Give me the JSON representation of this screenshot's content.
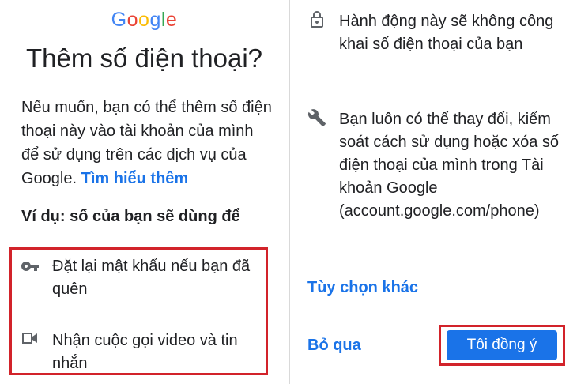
{
  "logo": {
    "letters": [
      {
        "ch": "G",
        "color": "#4285F4"
      },
      {
        "ch": "o",
        "color": "#EA4335"
      },
      {
        "ch": "o",
        "color": "#FBBC05"
      },
      {
        "ch": "g",
        "color": "#4285F4"
      },
      {
        "ch": "l",
        "color": "#34A853"
      },
      {
        "ch": "e",
        "color": "#EA4335"
      }
    ]
  },
  "left": {
    "title": "Thêm số điện thoại?",
    "body": "Nếu muốn, bạn có thể thêm số điện thoại này vào tài khoản của mình để sử dụng trên các dịch vụ của Google.",
    "learn_more": "Tìm hiểu thêm",
    "subhead": "Ví dụ: số của bạn sẽ dùng để",
    "items": [
      {
        "icon": "key-icon",
        "line1": "Đặt lại mật khẩu nếu bạn đã",
        "line2": "quên"
      },
      {
        "icon": "video-camera-icon",
        "line1": "Nhận cuộc gọi video và tin",
        "line2": "nhắn"
      }
    ]
  },
  "right": {
    "items": [
      {
        "icon": "lock-icon",
        "text": "Hành động này sẽ không công khai số điện thoại của bạn"
      },
      {
        "icon": "wrench-icon",
        "text": "Bạn luôn có thể thay đổi, kiểm soát cách sử dụng hoặc xóa số điện thoại của mình trong Tài khoản Google (account.google.com/phone)"
      }
    ],
    "more_options": "Tùy chọn khác",
    "skip": "Bỏ qua",
    "agree": "Tôi đồng ý"
  },
  "colors": {
    "accent": "#1a73e8",
    "highlight_border": "#d2232a",
    "icon_gray": "#5f6368"
  }
}
